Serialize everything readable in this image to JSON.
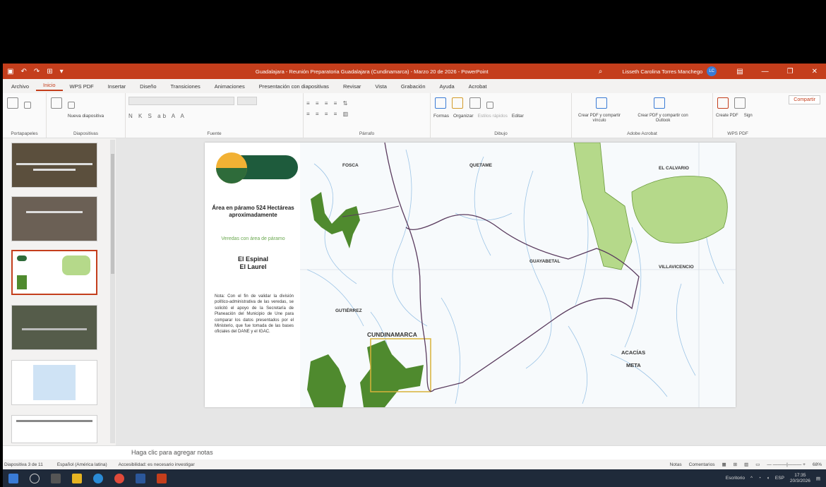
{
  "titlebar": {
    "title": "Guadalajara - Reunión Preparatoria Guadalajara (Cundinamarca) - Marzo 20 de 2026 - PowerPoint",
    "user": "Lisseth Carolina Torres Manchego",
    "avatar": "LC"
  },
  "tabs": [
    "Archivo",
    "Inicio",
    "WPS PDF",
    "Insertar",
    "Diseño",
    "Transiciones",
    "Animaciones",
    "Presentación con diapositivas",
    "Revisar",
    "Vista",
    "Grabación",
    "Ayuda",
    "Acrobat"
  ],
  "active_tab": "Inicio",
  "share_label": "Compartir",
  "ribbon": {
    "groups": [
      "Portapapeles",
      "Diapositivas",
      "Fuente",
      "Párrafo",
      "Dibujo",
      "Adobe Acrobat",
      "WPS PDF"
    ],
    "new_slide": "Nueva diapositiva",
    "shapes": "Formas",
    "arrange": "Organizar",
    "quick_styles": "Estilos rápidos",
    "edit": "Editar",
    "create_pdf": "Crear PDF y compartir vínculo",
    "create_pdf_outlook": "Crear PDF y compartir con Outlook",
    "wps_create": "Create PDF",
    "wps_sign": "Sign"
  },
  "slide": {
    "area_title": "Área en páramo 524 Hectáreas aproximadamente",
    "area_sub": "Veredas con área de páramo",
    "veredas": [
      "El Espinal",
      "El Laurel"
    ],
    "note": "Nota: Con el fin de validar la división político-administrativa de las veredas, se solicitó el apoyo de la Secretaría de Planeación del Municipio de Une para comparar los datos presentados por el Ministerio, que fue tomada de las bases oficiales del DANE y el IGAC.",
    "map_labels": {
      "fosca": "FOSCA",
      "quetame": "QUETAME",
      "el_calvario": "EL CALVARIO",
      "guayabetal": "GUAYABETAL",
      "villavicencio": "VILLAVICENCIO",
      "gutierrez": "GUTIÉRREZ",
      "cundinamarca": "CUNDINAMARCA",
      "acacias": "ACACÍAS",
      "meta": "META"
    }
  },
  "notes_placeholder": "Haga clic para agregar notas",
  "status": {
    "slide_info": "Diapositiva 3 de 11",
    "language": "Español (América latina)",
    "accessibility": "Accesibilidad: es necesario investigar",
    "notes_btn": "Notas",
    "comments_btn": "Comentarios",
    "zoom": "68%"
  },
  "taskbar": {
    "weather": "Escritorio",
    "lang": "ESP",
    "time": "17:35",
    "date": "20/3/2026"
  },
  "colors": {
    "accent": "#c43e1c",
    "paramo_dark": "#4f8a2e",
    "paramo_light": "#b5d98a",
    "taskbar": "#1f2a3a"
  }
}
